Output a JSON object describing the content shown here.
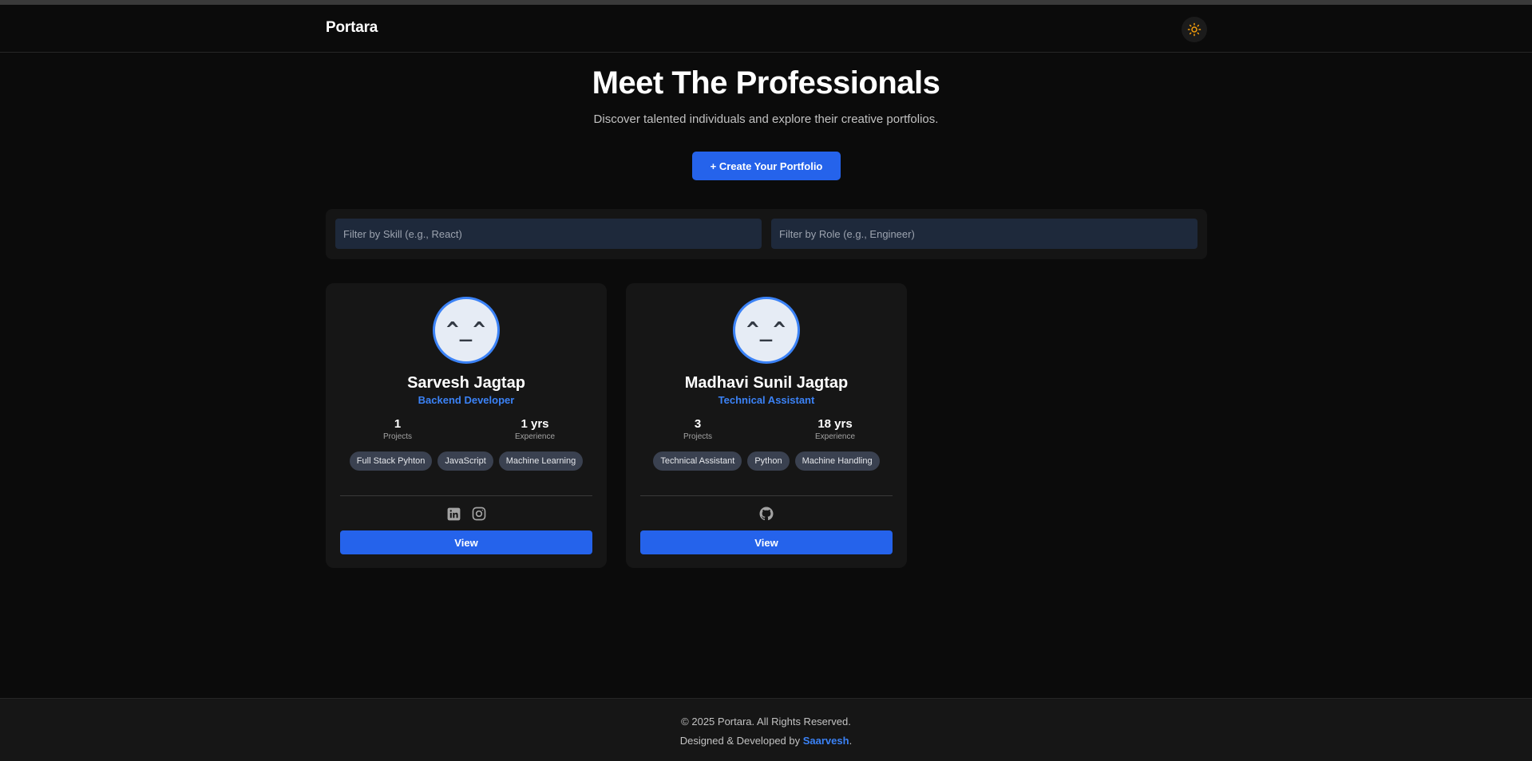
{
  "navbar": {
    "brand": "Portara",
    "theme_toggle_icon": "sun-icon",
    "accent_color": "#f59e0b"
  },
  "hero": {
    "title": "Meet The Professionals",
    "subtitle": "Discover talented individuals and explore their creative portfolios.",
    "create_button_label": "+ Create Your Portfolio"
  },
  "filters": {
    "skill_placeholder": "Filter by Skill (e.g., React)",
    "role_placeholder": "Filter by Role (e.g., Engineer)",
    "skill_value": "",
    "role_value": ""
  },
  "profiles": [
    {
      "avatar_text": "^_^",
      "name": "Sarvesh Jagtap",
      "role": "Backend Developer",
      "projects_value": "1",
      "projects_label": "Projects",
      "experience_value": "1 yrs",
      "experience_label": "Experience",
      "skills": [
        "Full Stack Pyhton",
        "JavaScript",
        "Machine Learning"
      ],
      "socials": [
        "linkedin-icon",
        "instagram-icon"
      ],
      "view_label": "View"
    },
    {
      "avatar_text": "^_^",
      "name": "Madhavi Sunil Jagtap",
      "role": "Technical Assistant",
      "projects_value": "3",
      "projects_label": "Projects",
      "experience_value": "18 yrs",
      "experience_label": "Experience",
      "skills": [
        "Technical Assistant",
        "Python",
        "Machine Handling"
      ],
      "socials": [
        "github-icon"
      ],
      "view_label": "View"
    }
  ],
  "footer": {
    "copyright": "© 2025 Portara. All Rights Reserved.",
    "credit_prefix": "Designed & Developed by ",
    "credit_name": "Saarvesh",
    "credit_suffix": "."
  },
  "colors": {
    "background": "#0b0b0b",
    "card": "#161616",
    "accent": "#2563eb",
    "role_text": "#3b82f6"
  }
}
